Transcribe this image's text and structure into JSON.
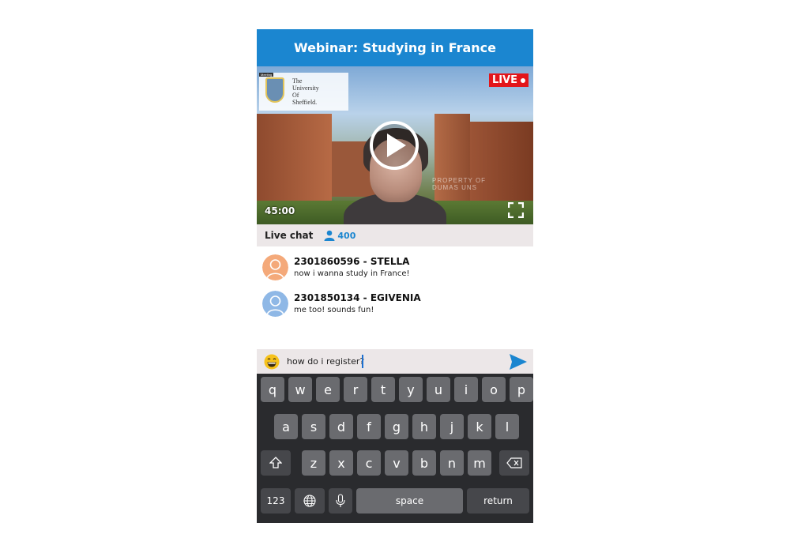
{
  "header": {
    "title": "Webinar: Studying in France"
  },
  "video": {
    "live_label": "LIVE",
    "duration": "45:00",
    "logo_lines": [
      "The",
      "University",
      "Of",
      "Sheffield."
    ],
    "logo_tag": "Meeting",
    "watermark_lines": [
      "PROPERTY OF",
      "DUMAS UNS"
    ]
  },
  "chat": {
    "label": "Live chat",
    "viewer_count": "400",
    "messages": [
      {
        "name": "2301860596 - STELLA",
        "text": "now i wanna study in France!",
        "avatar_color": "#f4a97a"
      },
      {
        "name": "2301850134 - EGIVENIA",
        "text": "me too! sounds fun!",
        "avatar_color": "#8fb8e6"
      }
    ]
  },
  "input": {
    "value": "how do i register?"
  },
  "keyboard": {
    "row1": [
      "q",
      "w",
      "e",
      "r",
      "t",
      "y",
      "u",
      "i",
      "o",
      "p"
    ],
    "row2": [
      "a",
      "s",
      "d",
      "f",
      "g",
      "h",
      "j",
      "k",
      "l"
    ],
    "row3": [
      "z",
      "x",
      "c",
      "v",
      "b",
      "n",
      "m"
    ],
    "numbers_label": "123",
    "space_label": "space",
    "return_label": "return"
  },
  "colors": {
    "accent": "#1b86d0",
    "live": "#e3151a",
    "keyboard_bg": "#2a2b2e"
  }
}
